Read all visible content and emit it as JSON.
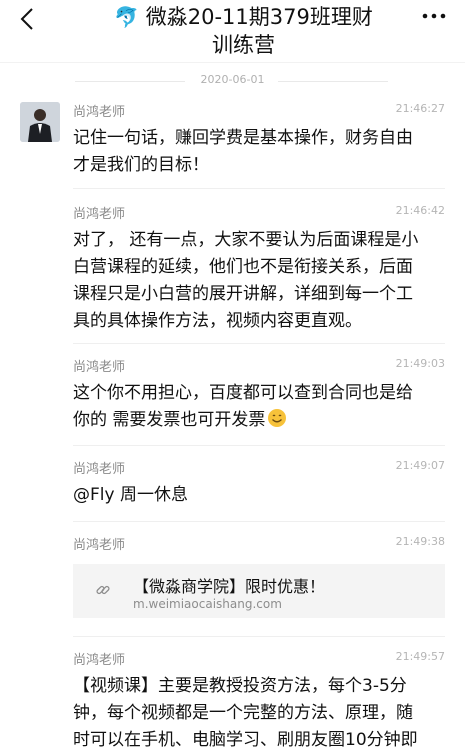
{
  "header": {
    "icon": "dolphin-emoji",
    "title_line1": "微淼20-11期379班理财",
    "title_line2": "训练营"
  },
  "date_divider": "2020-06-01",
  "messages": [
    {
      "sender": "尚鸿老师",
      "time": "21:46:27",
      "lines": [
        "记住一句话，赚回学费是基本操作，财务自由",
        "才是我们的目标！"
      ]
    },
    {
      "sender": "尚鸿老师",
      "time": "21:46:42",
      "lines": [
        "对了， 还有一点，大家不要认为后面课程是小",
        "白营课程的延续，他们也不是衔接关系，后面",
        "课程只是小白营的展开讲解，详细到每一个工",
        "具的具体操作方法，视频内容更直观。"
      ]
    },
    {
      "sender": "尚鸿老师",
      "time": "21:49:03",
      "lines": [
        "这个你不用担心，百度都可以查到合同也是给",
        "你的  需要发票也可开发票"
      ],
      "emoji": "smiling-face-emoji"
    },
    {
      "sender": "尚鸿老师",
      "time": "21:49:07",
      "lines": [
        "@Fly  周一休息"
      ]
    },
    {
      "sender": "尚鸿老师",
      "time": "21:49:38",
      "link_title": "【微淼商学院】限时优惠！",
      "link_url": "m.weimiaocaishang.com"
    },
    {
      "sender": "尚鸿老师",
      "time": "21:49:57",
      "lines": [
        "【视频课】主要是教授投资方法，每个3-5分",
        "钟，每个视频都是一个完整的方法、原理，随",
        "时可以在手机、电脑学习、刷朋友圈10分钟即"
      ]
    }
  ]
}
